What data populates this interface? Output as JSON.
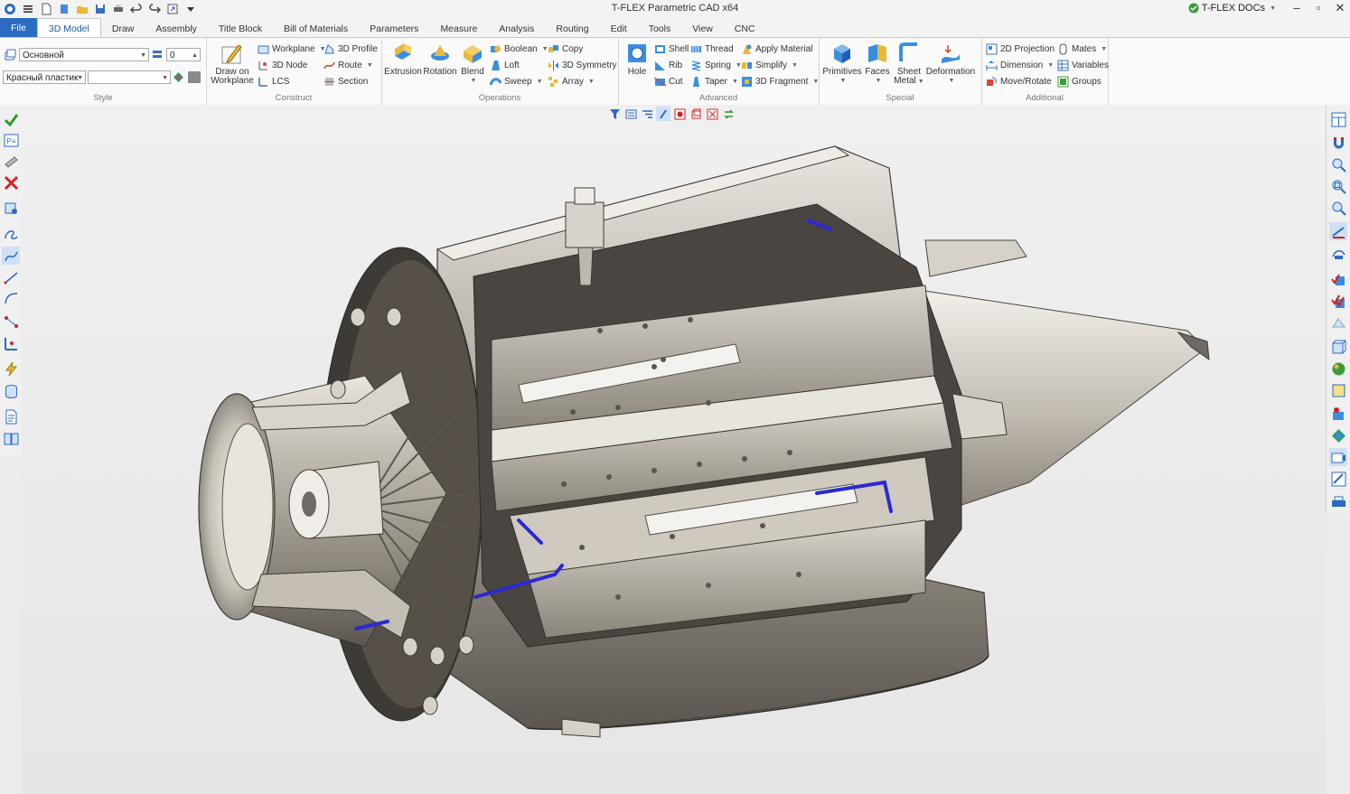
{
  "window": {
    "title": "T-FLEX Parametric CAD x64",
    "docs_label": "T-FLEX DOCs"
  },
  "tabs": [
    "File",
    "3D Model",
    "Draw",
    "Assembly",
    "Title Block",
    "Bill of Materials",
    "Parameters",
    "Measure",
    "Analysis",
    "Routing",
    "Edit",
    "Tools",
    "View",
    "CNC"
  ],
  "active_tab": "3D Model",
  "ribbon": {
    "style": {
      "label": "Style",
      "layer_value": "Основной",
      "level_value": "0",
      "material_value": "Красный пластик",
      "color_value": ""
    },
    "construct": {
      "label": "Construct",
      "draw_on_workplane_l1": "Draw on",
      "draw_on_workplane_l2": "Workplane",
      "workplane": "Workplane",
      "node": "3D Node",
      "lcs": "LCS",
      "profile": "3D Profile",
      "route": "Route",
      "section": "Section"
    },
    "operations": {
      "label": "Operations",
      "extrusion": "Extrusion",
      "rotation": "Rotation",
      "blend": "Blend",
      "boolean": "Boolean",
      "loft": "Loft",
      "sweep": "Sweep",
      "copy": "Copy",
      "symmetry": "3D Symmetry",
      "array": "Array"
    },
    "advanced": {
      "label": "Advanced",
      "hole": "Hole",
      "shell": "Shell",
      "rib": "Rib",
      "cut": "Cut",
      "thread": "Thread",
      "spring": "Spring",
      "taper": "Taper",
      "apply_material": "Apply Material",
      "simplify": "Simplify",
      "fragment": "3D Fragment"
    },
    "special": {
      "label": "Special",
      "primitives": "Primitives",
      "faces": "Faces",
      "sheet_metal_l1": "Sheet",
      "sheet_metal_l2": "Metal",
      "deformation": "Deformation"
    },
    "additional": {
      "label": "Additional",
      "projection": "2D Projection",
      "dimension": "Dimension",
      "move_rotate": "Move/Rotate",
      "mates": "Mates",
      "variables": "Variables",
      "groups": "Groups"
    }
  },
  "colors": {
    "accent": "#2b6bc1",
    "metal": "#c9c4bc",
    "pipe": "#2a2ad0"
  }
}
